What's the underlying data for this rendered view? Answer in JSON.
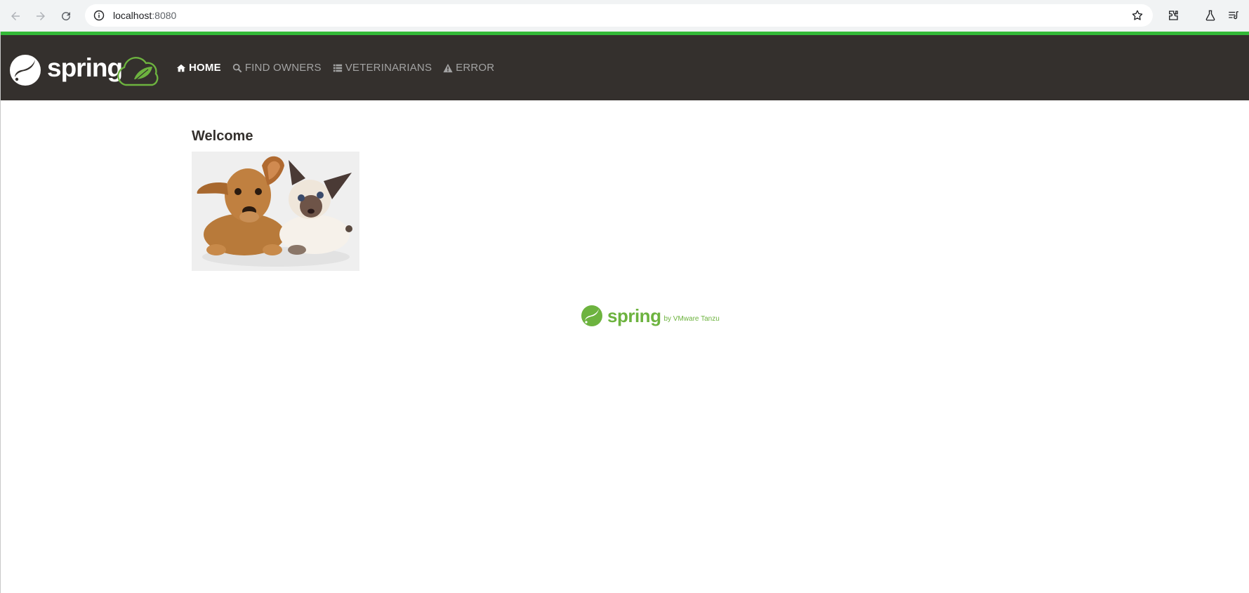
{
  "browser": {
    "url_host": "localhost",
    "url_port": ":8080"
  },
  "navbar": {
    "items": [
      {
        "label": "HOME",
        "icon": "home-icon",
        "active": true
      },
      {
        "label": "FIND OWNERS",
        "icon": "search-icon",
        "active": false
      },
      {
        "label": "VETERINARIANS",
        "icon": "list-icon",
        "active": false
      },
      {
        "label": "ERROR",
        "icon": "warning-icon",
        "active": false
      }
    ]
  },
  "main": {
    "title": "Welcome"
  },
  "footer": {
    "logo_word": "spring",
    "logo_byline": "by VMware Tanzu"
  },
  "colors": {
    "navbar_bg": "#34302d",
    "accent_green": "#34b938",
    "spring_green": "#6db33f"
  }
}
